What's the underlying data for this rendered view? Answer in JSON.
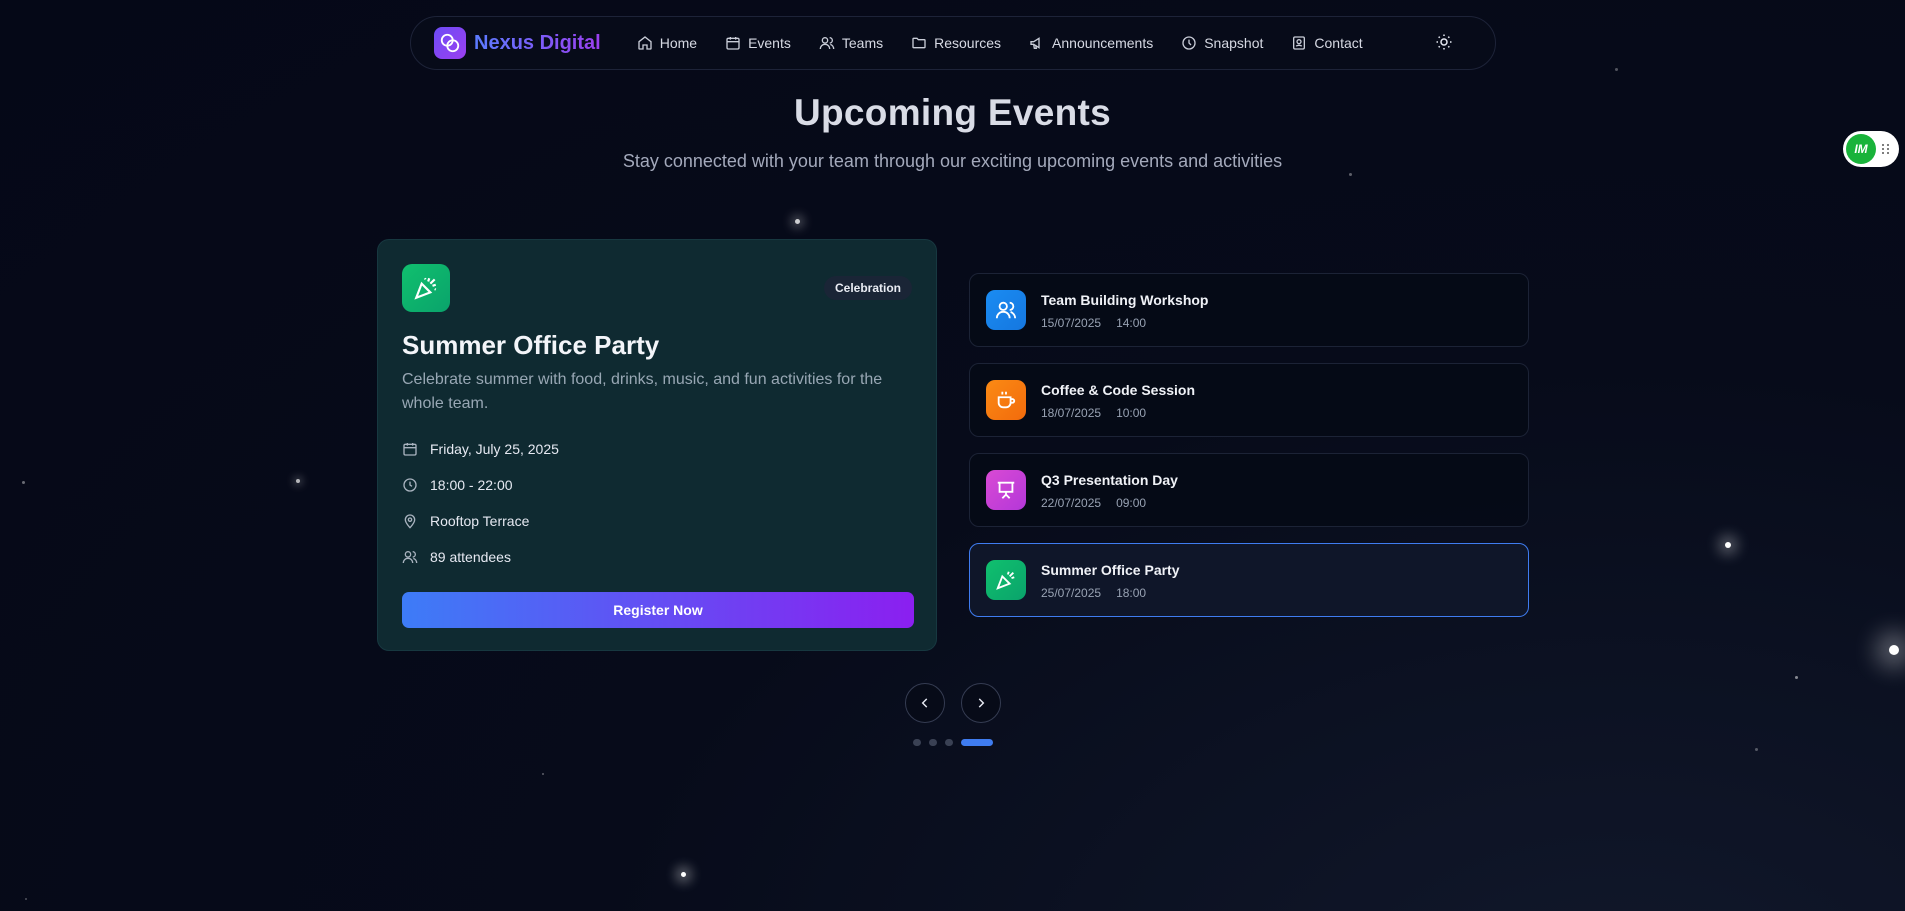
{
  "nav": {
    "brand": "Nexus Digital",
    "items": [
      {
        "label": "Home",
        "icon": "home-icon"
      },
      {
        "label": "Events",
        "icon": "calendar-icon"
      },
      {
        "label": "Teams",
        "icon": "users-icon"
      },
      {
        "label": "Resources",
        "icon": "folder-icon"
      },
      {
        "label": "Announcements",
        "icon": "megaphone-icon"
      },
      {
        "label": "Snapshot",
        "icon": "snapshot-icon"
      },
      {
        "label": "Contact",
        "icon": "contact-icon"
      }
    ],
    "theme_icon": "sun-icon"
  },
  "hero": {
    "title": "Upcoming Events",
    "subtitle": "Stay connected with your team through our exciting upcoming events and activities"
  },
  "featured": {
    "icon": "party-popper-icon",
    "badge": "Celebration",
    "title": "Summer Office Party",
    "description": "Celebrate summer with food, drinks, music, and fun activities for the whole team.",
    "date": "Friday, July 25, 2025",
    "time": "18:00 - 22:00",
    "location": "Rooftop Terrace",
    "attendees": "89 attendees",
    "cta": "Register Now"
  },
  "events": [
    {
      "title": "Team Building Workshop",
      "date": "15/07/2025",
      "time": "14:00",
      "icon": "users-icon",
      "color": "#1a8cf2"
    },
    {
      "title": "Coffee & Code Session",
      "date": "18/07/2025",
      "time": "10:00",
      "icon": "coffee-icon",
      "color": "#fb7c10"
    },
    {
      "title": "Q3 Presentation Day",
      "date": "22/07/2025",
      "time": "09:00",
      "icon": "presentation-icon",
      "color": "#cc3fd6"
    },
    {
      "title": "Summer Office Party",
      "date": "25/07/2025",
      "time": "18:00",
      "icon": "party-popper-icon",
      "color": "#12b76a"
    }
  ],
  "carousel": {
    "pages": 4,
    "active_index": 3
  },
  "floating_widget": {
    "label": "IM"
  },
  "colors": {
    "accent": "#3f7cf0",
    "brand_gradient_end": "#8b1ff0"
  }
}
